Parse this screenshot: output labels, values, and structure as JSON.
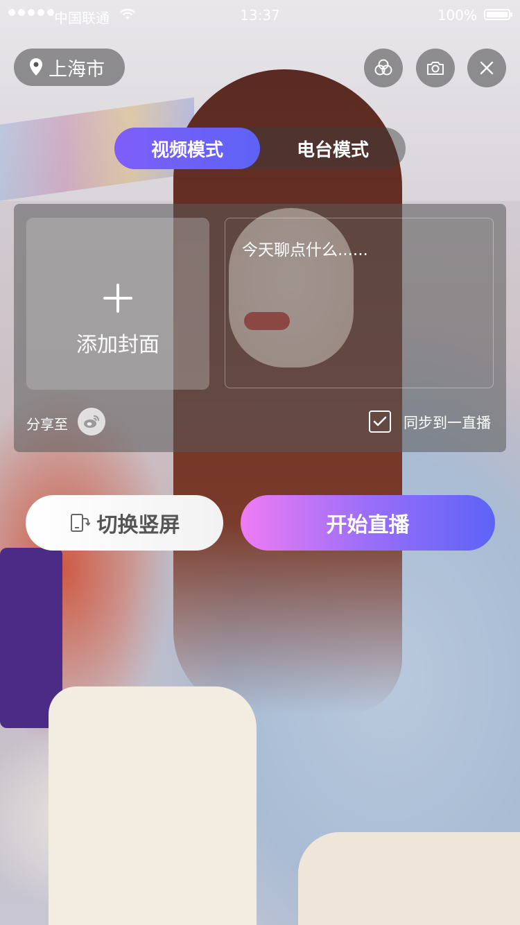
{
  "status_bar": {
    "carrier": "中国联通",
    "time": "13:37",
    "battery_percent": "100%"
  },
  "top_controls": {
    "location_label": "上海市",
    "icons": [
      "location-pin-icon",
      "filter-icon",
      "camera-switch-icon",
      "close-icon"
    ]
  },
  "mode_tabs": [
    {
      "label": "视频模式",
      "selected": true
    },
    {
      "label": "电台模式",
      "selected": false
    }
  ],
  "setup_panel": {
    "cover_label": "添加封面",
    "topic_placeholder": "今天聊点什么......",
    "share_label": "分享至",
    "share_targets": [
      "weibo-icon"
    ],
    "sync_label": "同步到一直播",
    "sync_checked": true
  },
  "actions": {
    "switch_orientation_label": "切换竖屏",
    "start_live_label": "开始直播"
  },
  "colors": {
    "accent_purple": "#7e5ef8",
    "start_gradient_start": "#ee7cf3",
    "start_gradient_end": "#5d63f7"
  }
}
